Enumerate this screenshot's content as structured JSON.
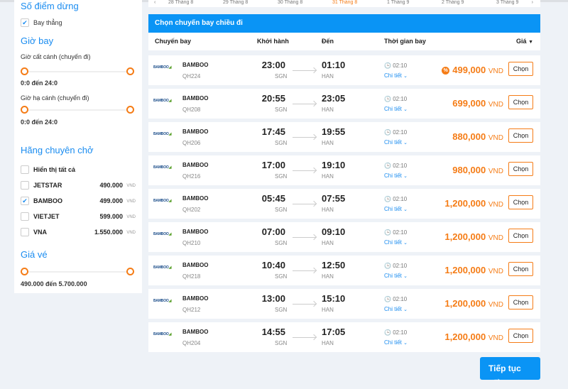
{
  "filters": {
    "stops_title": "Số điểm dừng",
    "direct_label": "Bay thẳng",
    "time_title": "Giờ bay",
    "depart_label": "Giờ cất cánh (chuyến đi)",
    "depart_range": "0:0 đến 24:0",
    "land_label": "Giờ hạ cánh (chuyến đi)",
    "land_range": "0:0 đến 24:0",
    "airline_title": "Hãng chuyên chở",
    "show_all": "Hiển thị tất cả",
    "airlines": [
      {
        "name": "JETSTAR",
        "price": "490.000",
        "cur": "VND",
        "checked": false
      },
      {
        "name": "BAMBOO",
        "price": "499.000",
        "cur": "VND",
        "checked": true
      },
      {
        "name": "VIETJET",
        "price": "599.000",
        "cur": "VND",
        "checked": false
      },
      {
        "name": "VNA",
        "price": "1.550.000",
        "cur": "VND",
        "checked": false
      }
    ],
    "price_title": "Giá vé",
    "price_range": "490.000 đến 5.700.000"
  },
  "dates": [
    "28 Tháng 8",
    "29 Tháng 8",
    "30 Tháng 8",
    "31 Tháng 8",
    "1 Tháng 9",
    "2 Tháng 9",
    "3 Tháng 9"
  ],
  "selected_date": "31 Tháng 8",
  "header": "Chọn chuyến bay chiều đi",
  "columns": {
    "flight": "Chuyến bay",
    "depart": "Khởi hành",
    "arrive": "Đến",
    "duration": "Thời gian bay",
    "price": "Giá"
  },
  "flights": [
    {
      "airline": "BAMBOO",
      "code": "QH224",
      "dep": "23:00",
      "from": "SGN",
      "arr": "01:10",
      "to": "HAN",
      "dur": "02:10",
      "price": "499,000",
      "discount": true
    },
    {
      "airline": "BAMBOO",
      "code": "QH208",
      "dep": "20:55",
      "from": "SGN",
      "arr": "23:05",
      "to": "HAN",
      "dur": "02:10",
      "price": "699,000"
    },
    {
      "airline": "BAMBOO",
      "code": "QH206",
      "dep": "17:45",
      "from": "SGN",
      "arr": "19:55",
      "to": "HAN",
      "dur": "02:10",
      "price": "880,000"
    },
    {
      "airline": "BAMBOO",
      "code": "QH216",
      "dep": "17:00",
      "from": "SGN",
      "arr": "19:10",
      "to": "HAN",
      "dur": "02:10",
      "price": "980,000"
    },
    {
      "airline": "BAMBOO",
      "code": "QH202",
      "dep": "05:45",
      "from": "SGN",
      "arr": "07:55",
      "to": "HAN",
      "dur": "02:10",
      "price": "1,200,000"
    },
    {
      "airline": "BAMBOO",
      "code": "QH210",
      "dep": "07:00",
      "from": "SGN",
      "arr": "09:10",
      "to": "HAN",
      "dur": "02:10",
      "price": "1,200,000"
    },
    {
      "airline": "BAMBOO",
      "code": "QH218",
      "dep": "10:40",
      "from": "SGN",
      "arr": "12:50",
      "to": "HAN",
      "dur": "02:10",
      "price": "1,200,000"
    },
    {
      "airline": "BAMBOO",
      "code": "QH212",
      "dep": "13:00",
      "from": "SGN",
      "arr": "15:10",
      "to": "HAN",
      "dur": "02:10",
      "price": "1,200,000"
    },
    {
      "airline": "BAMBOO",
      "code": "QH204",
      "dep": "14:55",
      "from": "SGN",
      "arr": "17:05",
      "to": "HAN",
      "dur": "02:10",
      "price": "1,200,000"
    }
  ],
  "currency": "VND",
  "detail_label": "Chi tiết",
  "choose_label": "Chọn",
  "logo_text": "BAMBOO",
  "next_label": "Tiếp tục"
}
